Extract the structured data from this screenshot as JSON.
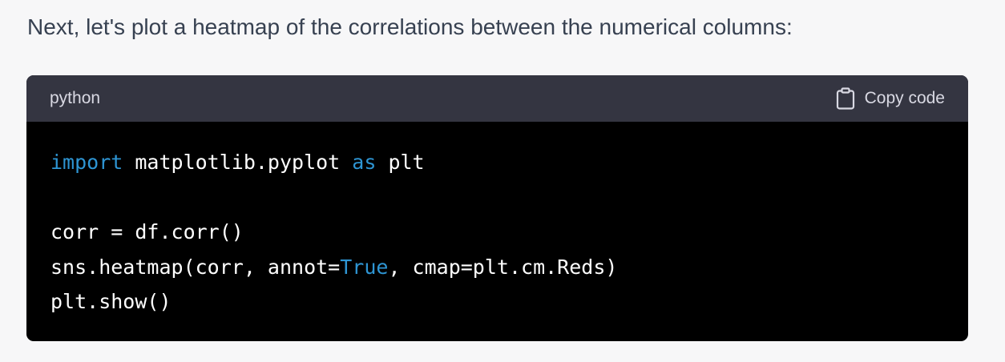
{
  "message": {
    "intro_text": "Next, let's plot a heatmap of the correlations between the numerical columns:"
  },
  "code_block": {
    "language": "python",
    "copy_label": "Copy code",
    "copy_icon": "clipboard-icon",
    "lines": [
      [
        {
          "text": "import",
          "kind": "keyword"
        },
        {
          "text": " matplotlib.pyplot ",
          "kind": "plain"
        },
        {
          "text": "as",
          "kind": "keyword"
        },
        {
          "text": " plt",
          "kind": "plain"
        }
      ],
      [],
      [
        {
          "text": "corr = df.corr()",
          "kind": "plain"
        }
      ],
      [
        {
          "text": "sns.heatmap(corr, annot=",
          "kind": "plain"
        },
        {
          "text": "True",
          "kind": "boolean"
        },
        {
          "text": ", cmap=plt.cm.Reds)",
          "kind": "plain"
        }
      ],
      [
        {
          "text": "plt.show()",
          "kind": "plain"
        }
      ]
    ]
  },
  "colors": {
    "page_background": "#f7f7f8",
    "header_background": "#343541",
    "code_background": "#000000",
    "keyword": "#2e95d3",
    "text": "#ffffff"
  }
}
